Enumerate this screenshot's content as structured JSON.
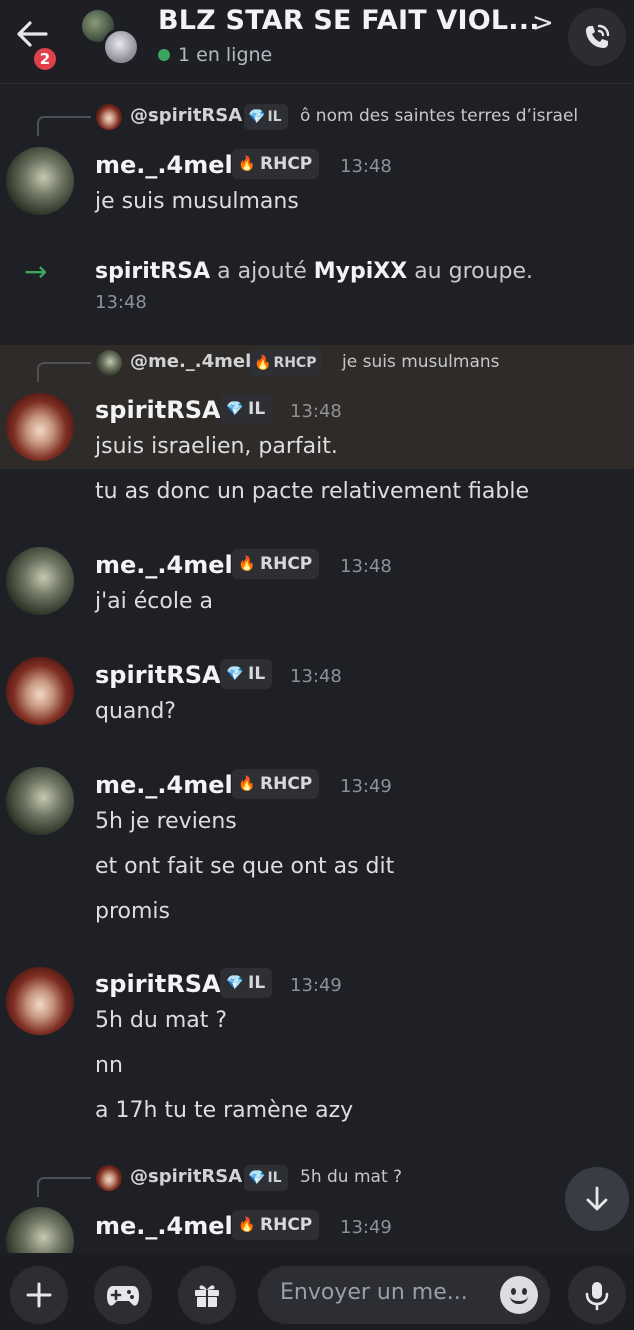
{
  "header": {
    "title": "BLZ STAR SE FAIT VIOL...",
    "chevron": ">",
    "unread_count": "2",
    "status": "1 en ligne",
    "online_color": "#3ba55d"
  },
  "tags": {
    "rhcp": "RHCP",
    "il": "IL"
  },
  "messages": [
    {
      "reply": {
        "author": "@spiritRSA",
        "tag": "IL",
        "text": "ô nom des saintes terres d’israel"
      },
      "author": "me._.4mel",
      "tag": "RHCP",
      "time": "13:48",
      "lines": [
        "je suis musulmans"
      ]
    },
    {
      "system": {
        "actor": "spiritRSA",
        "verb": "a ajouté",
        "target": "MypiXX",
        "rest": "au groupe.",
        "time": "13:48"
      }
    },
    {
      "reply": {
        "author": "@me._.4mel",
        "tag": "RHCP",
        "text": "je suis musulmans"
      },
      "author": "spiritRSA",
      "tag": "IL",
      "time": "13:48",
      "lines": [
        "jsuis israelien, parfait.",
        "tu as donc un pacte relativement fiable"
      ]
    },
    {
      "author": "me._.4mel",
      "tag": "RHCP",
      "time": "13:48",
      "lines": [
        "j'ai école a"
      ]
    },
    {
      "author": "spiritRSA",
      "tag": "IL",
      "time": "13:48",
      "lines": [
        "quand?"
      ]
    },
    {
      "author": "me._.4mel",
      "tag": "RHCP",
      "time": "13:49",
      "lines": [
        "5h je reviens",
        "et ont fait se que ont as dit",
        "promis"
      ]
    },
    {
      "author": "spiritRSA",
      "tag": "IL",
      "time": "13:49",
      "lines": [
        "5h du mat ?",
        "nn",
        "a 17h tu te ramène azy"
      ]
    },
    {
      "reply": {
        "author": "@spiritRSA",
        "tag": "IL",
        "text": "5h du mat ?"
      },
      "author": "me._.4mel",
      "tag": "RHCP",
      "time": "13:49",
      "lines": []
    }
  ],
  "composer": {
    "placeholder": "Envoyer un me..."
  },
  "icons": {
    "back": "arrow-left-icon",
    "call": "phone-call-icon",
    "add": "plus-icon",
    "games": "gamepad-icon",
    "gift": "gift-icon",
    "emoji": "emoji-icon",
    "mic": "microphone-icon",
    "scroll": "arrow-down-icon",
    "system": "arrow-right-icon"
  }
}
